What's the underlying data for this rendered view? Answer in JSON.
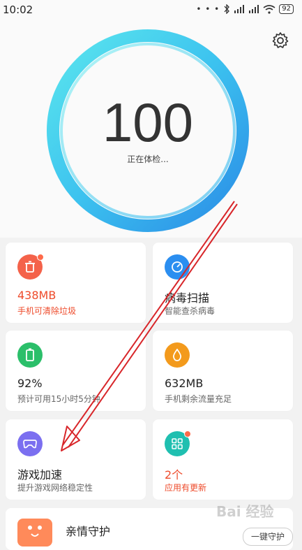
{
  "status_bar": {
    "time": "10:02",
    "dots": "• • •",
    "battery": "92"
  },
  "header": {
    "settings_icon": "gear-icon"
  },
  "score": {
    "value": "100",
    "status": "正在体检..."
  },
  "cards": [
    {
      "title": "438MB",
      "sub": "手机可清除垃圾",
      "icon": "trash-icon",
      "color": "#f4624a",
      "highlight": true,
      "badge": true
    },
    {
      "title": "病毒扫描",
      "sub": "智能查杀病毒",
      "icon": "scan-icon",
      "color": "#2b8ef0",
      "highlight": false,
      "badge": false
    },
    {
      "title": "92%",
      "sub": "预计可用15小时5分钟",
      "icon": "battery-icon",
      "color": "#2bbf6a",
      "highlight": false,
      "badge": false
    },
    {
      "title": "632MB",
      "sub": "手机剩余流量充足",
      "icon": "droplet-icon",
      "color": "#f39a1c",
      "highlight": false,
      "badge": false
    },
    {
      "title": "游戏加速",
      "sub": "提升游戏网络稳定性",
      "icon": "gamepad-icon",
      "color": "#7b6ff0",
      "highlight": false,
      "badge": false
    },
    {
      "title": "2个",
      "sub": "应用有更新",
      "icon": "apps-icon",
      "color": "#1fbfb0",
      "highlight": true,
      "badge": true
    }
  ],
  "bottom": {
    "title": "亲情守护",
    "button": "一键守护"
  },
  "watermark": "Bai 经验"
}
